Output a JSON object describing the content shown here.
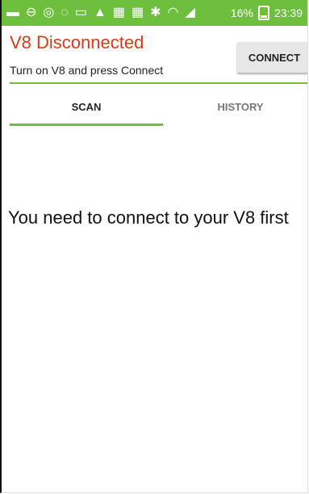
{
  "status_bar": {
    "icons": [
      "message-icon",
      "do-not-disturb-icon",
      "whatsapp-icon",
      "messenger-icon",
      "gallery-icon",
      "warning-icon",
      "image-icon",
      "image-icon",
      "bluetooth-icon",
      "wifi-icon",
      "signal-icon"
    ],
    "battery_text": "16%",
    "time": "23:39",
    "color": "#6fbf3f"
  },
  "header": {
    "title": "V8 Disconnected",
    "subtitle": "Turn on V8 and press Connect",
    "connect_label": "CONNECT",
    "title_color": "#d83b16"
  },
  "tabs": [
    {
      "label": "SCAN",
      "active": true
    },
    {
      "label": "HISTORY",
      "active": false
    }
  ],
  "main": {
    "message": "You need to connect to your V8 first"
  },
  "colors": {
    "accent": "#6fbf3f"
  }
}
